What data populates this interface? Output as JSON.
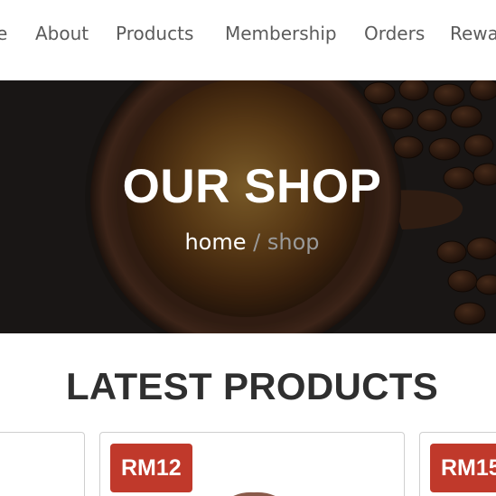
{
  "nav": {
    "items": [
      {
        "label": "e"
      },
      {
        "label": "About"
      },
      {
        "label": "Products"
      },
      {
        "label": "Membership"
      },
      {
        "label": "Orders"
      },
      {
        "label": "Rewa"
      }
    ]
  },
  "hero": {
    "title": "OUR SHOP",
    "breadcrumb": {
      "home": "home",
      "separator": "/",
      "current": "shop"
    }
  },
  "section": {
    "title": "LATEST PRODUCTS"
  },
  "products": [
    {
      "price": ""
    },
    {
      "price": "RM12"
    },
    {
      "price": "RM15"
    }
  ],
  "colors": {
    "badge": "#c0392b",
    "nav_text": "#5b5b5b",
    "heading": "#2f2f2f"
  }
}
